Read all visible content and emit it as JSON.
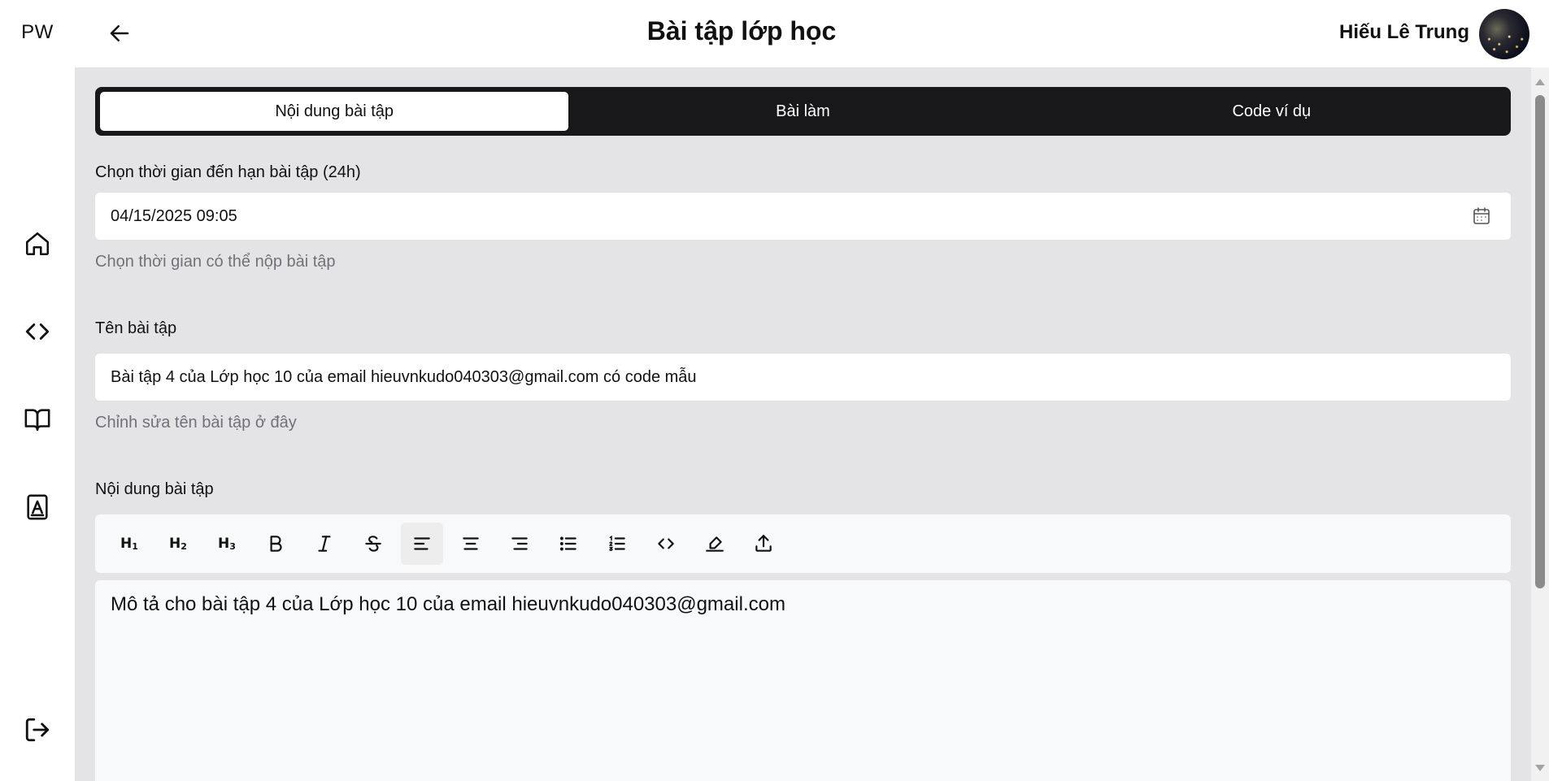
{
  "sidebar": {
    "logo": "PW",
    "items": [
      {
        "icon": "home-icon"
      },
      {
        "icon": "code-icon"
      },
      {
        "icon": "book-open-icon"
      },
      {
        "icon": "contact-book-icon"
      }
    ],
    "logout_icon": "logout-icon"
  },
  "header": {
    "title": "Bài tập lớp học",
    "user_name": "Hiếu Lê Trung",
    "back_icon": "arrow-left-icon"
  },
  "tabs": [
    {
      "label": "Nội dung bài tập",
      "active": true
    },
    {
      "label": "Bài làm",
      "active": false
    },
    {
      "label": "Code ví dụ",
      "active": false
    }
  ],
  "deadline": {
    "label": "Chọn thời gian đến hạn bài tập (24h)",
    "value": "04/15/2025 09:05",
    "hint": "Chọn thời gian có thể nộp bài tập",
    "icon": "calendar-icon"
  },
  "name": {
    "label": "Tên bài tập",
    "value": "Bài tập 4 của Lớp học 10 của email hieuvnkudo040303@gmail.com có code mẫu",
    "hint": "Chỉnh sửa tên bài tập ở đây"
  },
  "content": {
    "label": "Nội dung bài tập",
    "toolbar": [
      "heading-1",
      "heading-2",
      "heading-3",
      "bold",
      "italic",
      "strikethrough",
      "align-left",
      "align-center",
      "align-right",
      "bullet-list",
      "ordered-list",
      "code",
      "highlight",
      "upload"
    ],
    "active_tool": "align-left",
    "text": "Mô tả cho bài tập 4 của Lớp học 10 của email hieuvnkudo040303@gmail.com"
  },
  "colors": {
    "content_bg": "#e4e4e7",
    "tab_bar_bg": "#18181b",
    "hint_text": "#71717a"
  }
}
